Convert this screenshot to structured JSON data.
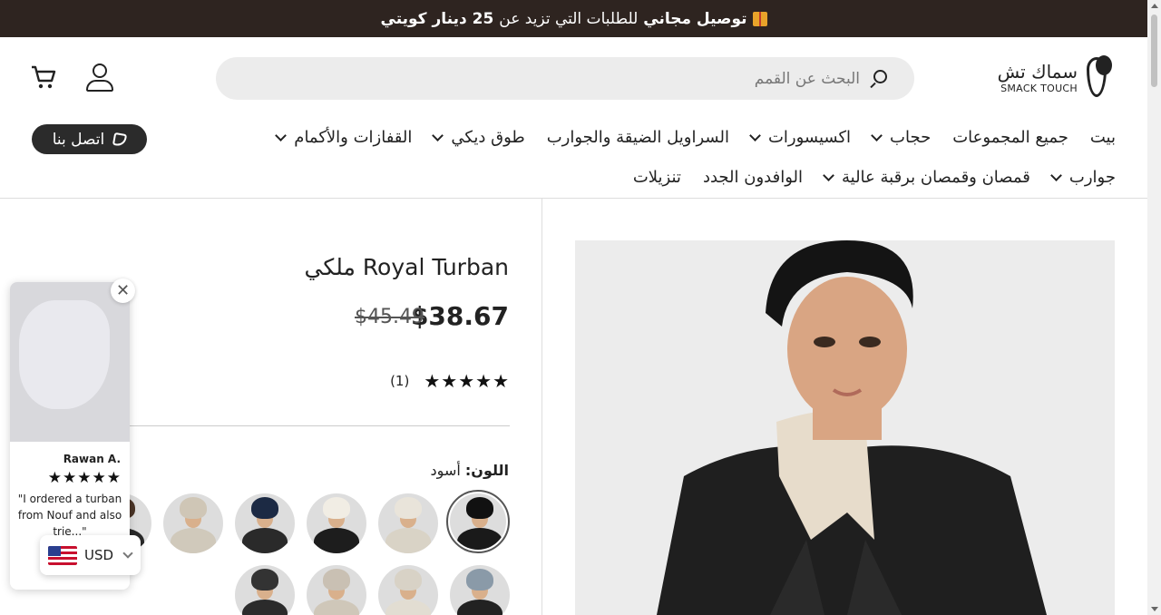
{
  "announcement": {
    "bold": "توصيل مجاني",
    "rest": "للطلبات التي تزيد عن",
    "amount": "25 دينار كويتي"
  },
  "logo": {
    "arabic": "سماك تش",
    "english": "SMACK TOUCH"
  },
  "search": {
    "placeholder": "البحث عن القمم"
  },
  "nav": {
    "row1": [
      {
        "label": "بيت",
        "dropdown": false
      },
      {
        "label": "جميع المجموعات",
        "dropdown": false
      },
      {
        "label": "حجاب",
        "dropdown": true
      },
      {
        "label": "اكسيسورات",
        "dropdown": true
      },
      {
        "label": "السراويل الضيقة والجوارب",
        "dropdown": false
      },
      {
        "label": "طوق ديكي",
        "dropdown": true
      },
      {
        "label": "القفازات والأكمام",
        "dropdown": true
      }
    ],
    "row2": [
      {
        "label": "جوارب",
        "dropdown": true
      },
      {
        "label": "قمصان وقمصان برقبة عالية",
        "dropdown": true
      },
      {
        "label": "الوافدون الجدد",
        "dropdown": false
      },
      {
        "label": "تنزيلات",
        "dropdown": false
      }
    ]
  },
  "contact": {
    "label": "اتصل بنا"
  },
  "product": {
    "title": "Royal Turban ملكي",
    "price": "$38.67",
    "compare_price": "$45.49",
    "rating_count": "(1)",
    "color_label": "اللون:",
    "color_value": "أسود"
  },
  "swatches": [
    {
      "cap": "#111111",
      "coat": "#1a1a1a"
    },
    {
      "cap": "#e9e4da",
      "coat": "#d9d3c6"
    },
    {
      "cap": "#f1ede4",
      "coat": "#1d1d1d"
    },
    {
      "cap": "#1c2a44",
      "coat": "#2a2a2a"
    },
    {
      "cap": "#cfc6b6",
      "coat": "#d0c9bb"
    },
    {
      "cap": "#4a3426",
      "coat": "#2a2a2a"
    },
    {
      "cap": "#8a9aa8",
      "coat": "#222222"
    },
    {
      "cap": "#d8d2c6",
      "coat": "#e2ddd2"
    },
    {
      "cap": "#c9c0b3",
      "coat": "#cfc7b9"
    },
    {
      "cap": "#333333",
      "coat": "#2b2b2b"
    }
  ],
  "review_popup": {
    "name": "Rawan A.",
    "quote": "\"I ordered a turban from Nouf and also trie...\""
  },
  "currency": {
    "code": "USD"
  },
  "colors": {
    "announcement_bg": "#2e2420",
    "button_bg": "#2b2b2b",
    "search_bg": "#ececec"
  }
}
